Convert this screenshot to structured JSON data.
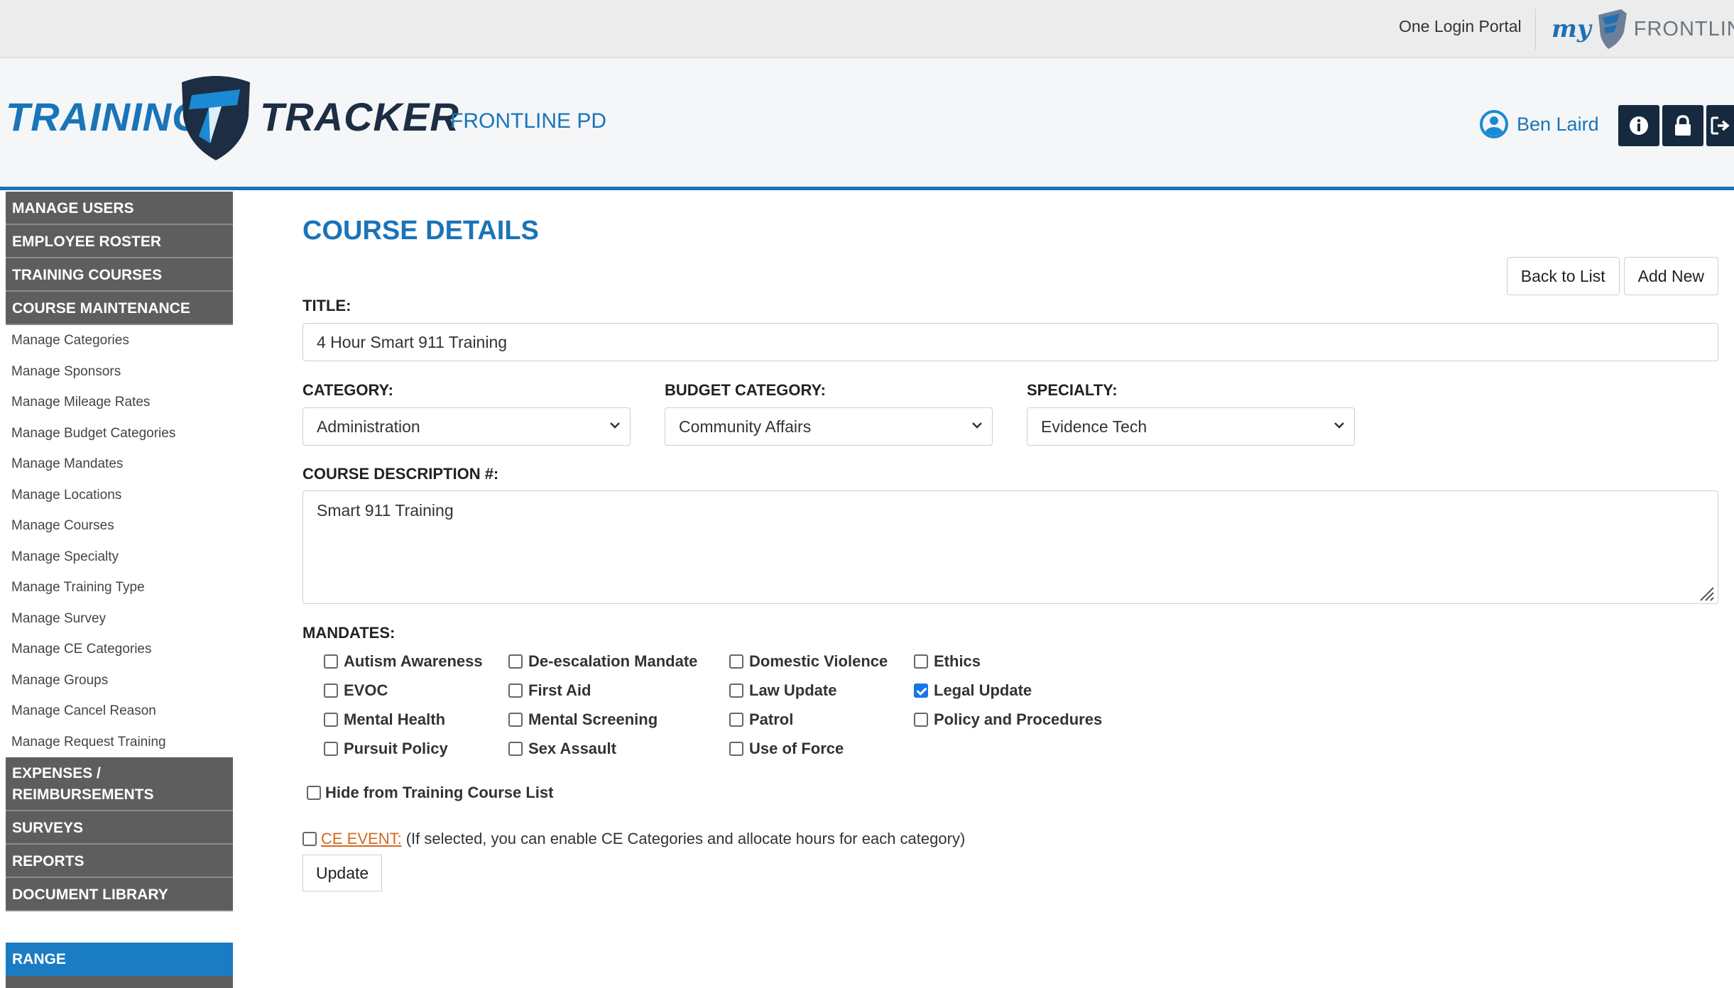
{
  "topbar": {
    "portal_link": "One Login Portal",
    "brand_my": "my",
    "brand_frontline": "FRONTLINE"
  },
  "header": {
    "logo_left": "TRAINING",
    "logo_right": "TRACKER",
    "agency": "FRONTLINE PD",
    "user_name": "Ben Laird",
    "icons": [
      "info-icon",
      "lock-icon",
      "logout-icon"
    ]
  },
  "sidebar": {
    "sections_top": [
      "MANAGE USERS",
      "EMPLOYEE ROSTER",
      "TRAINING COURSES",
      "COURSE MAINTENANCE"
    ],
    "sub_items": [
      "Manage Categories",
      "Manage Sponsors",
      "Manage Mileage Rates",
      "Manage Budget Categories",
      "Manage Mandates",
      "Manage Locations",
      "Manage Courses",
      "Manage Specialty",
      "Manage Training Type",
      "Manage Survey",
      "Manage CE Categories",
      "Manage Groups",
      "Manage Cancel Reason",
      "Manage Request Training"
    ],
    "expenses_line1": "EXPENSES /",
    "expenses_line2": "REIMBURSEMENTS",
    "sections_bottom": [
      "SURVEYS",
      "REPORTS",
      "DOCUMENT LIBRARY"
    ],
    "range": "RANGE"
  },
  "main": {
    "page_title": "COURSE DETAILS",
    "back_button": "Back to List",
    "add_button": "Add New",
    "title_label": "TITLE:",
    "title_value": "4 Hour Smart 911 Training",
    "category_label": "CATEGORY:",
    "category_value": "Administration",
    "budget_label": "BUDGET CATEGORY:",
    "budget_value": "Community Affairs",
    "specialty_label": "SPECIALTY:",
    "specialty_value": "Evidence Tech",
    "description_label": "COURSE DESCRIPTION #:",
    "description_value": "Smart 911 Training",
    "mandates_label": "MANDATES:",
    "mandates": [
      {
        "label": "Autism Awareness",
        "checked": false
      },
      {
        "label": "De-escalation Mandate",
        "checked": false
      },
      {
        "label": "Domestic Violence",
        "checked": false
      },
      {
        "label": "Ethics",
        "checked": false
      },
      {
        "label": "EVOC",
        "checked": false
      },
      {
        "label": "First Aid",
        "checked": false
      },
      {
        "label": "Law Update",
        "checked": false
      },
      {
        "label": "Legal Update",
        "checked": true
      },
      {
        "label": "Mental Health",
        "checked": false
      },
      {
        "label": "Mental Screening",
        "checked": false
      },
      {
        "label": "Patrol",
        "checked": false
      },
      {
        "label": "Policy and Procedures",
        "checked": false
      },
      {
        "label": "Pursuit Policy",
        "checked": false
      },
      {
        "label": "Sex Assault",
        "checked": false
      },
      {
        "label": "Use of Force",
        "checked": false
      }
    ],
    "hide_label": "Hide from Training Course List",
    "ce_link": "CE EVENT:",
    "ce_note": "(If selected, you can enable CE Categories and allocate hours for each category)",
    "update_button": "Update"
  },
  "colors": {
    "brand_blue": "#1a74b8",
    "nav_gray": "#5e5e5e",
    "range_blue": "#1a7cc3",
    "header_dark": "#16293f",
    "ce_orange": "#d2691e"
  }
}
